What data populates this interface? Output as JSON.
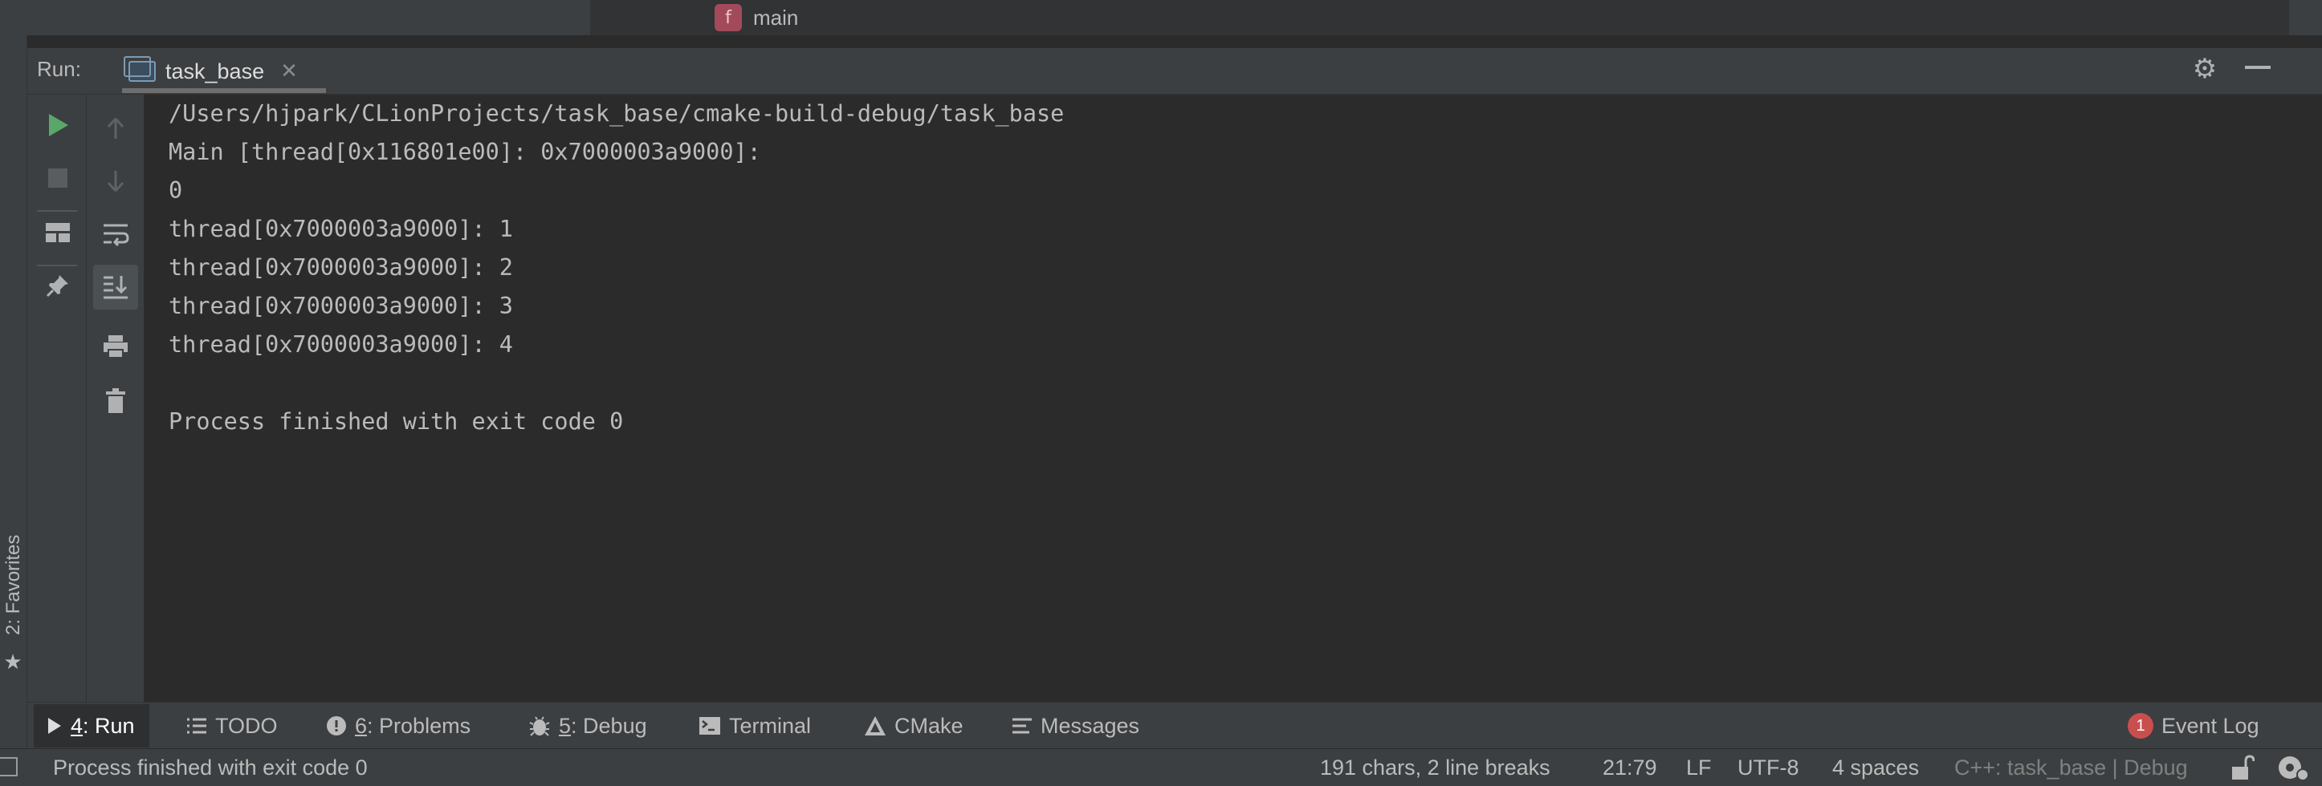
{
  "editor": {
    "breadcrumb_function": "main",
    "function_badge": "f"
  },
  "favorites": {
    "label": "2: Favorites"
  },
  "run_window": {
    "label": "Run:",
    "tab_label": "task_base",
    "tab_close": "✕"
  },
  "console": {
    "lines": [
      "/Users/hjpark/CLionProjects/task_base/cmake-build-debug/task_base",
      "Main [thread[0x116801e00]: 0x7000003a9000]:",
      "0",
      "thread[0x7000003a9000]: 1",
      "thread[0x7000003a9000]: 2",
      "thread[0x7000003a9000]: 3",
      "thread[0x7000003a9000]: 4",
      "",
      "Process finished with exit code 0"
    ]
  },
  "bottom_tabs": {
    "run": {
      "num": "4",
      "label": ": Run"
    },
    "todo": {
      "label": "TODO"
    },
    "problems": {
      "num": "6",
      "label": ": Problems"
    },
    "debug": {
      "num": "5",
      "label": ": Debug"
    },
    "terminal": {
      "label": "Terminal"
    },
    "cmake": {
      "label": "CMake"
    },
    "messages": {
      "label": "Messages"
    },
    "event_log": {
      "label": "Event Log",
      "count": "1"
    }
  },
  "status_bar": {
    "message": "Process finished with exit code 0",
    "selection": "191 chars, 2 line breaks",
    "position": "21:79",
    "line_separator": "LF",
    "encoding": "UTF-8",
    "indent": "4 spaces",
    "context": "C++: task_base | Debug"
  },
  "colors": {
    "accent_run": "#59a869",
    "badge_red": "#c94f4f",
    "background": "#2b2b2b",
    "panel": "#3c3f41"
  },
  "icons": [
    "run-icon",
    "stop-icon",
    "layout-icon",
    "pin-icon",
    "up-arrow-icon",
    "down-arrow-icon",
    "soft-wrap-icon",
    "scroll-to-end-icon",
    "print-icon",
    "trash-icon",
    "gear-icon",
    "minimize-icon",
    "console-icon",
    "function-icon",
    "star-icon",
    "play-icon",
    "list-icon",
    "info-icon",
    "bug-icon",
    "terminal-icon",
    "cmake-icon",
    "messages-icon",
    "lock-icon",
    "inspector-icon"
  ]
}
